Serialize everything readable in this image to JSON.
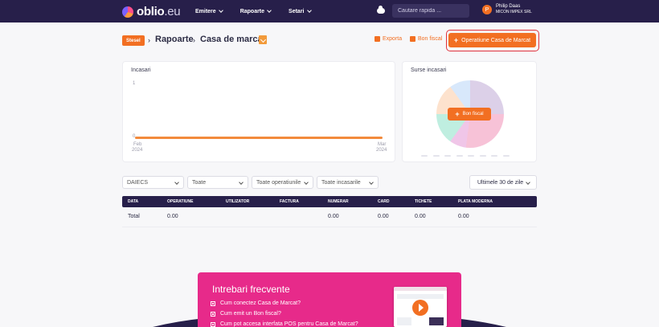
{
  "brand": {
    "logo_main": "oblio",
    "logo_suffix": ".eu"
  },
  "nav": {
    "items": [
      "Emitere",
      "Rapoarte",
      "Setari"
    ]
  },
  "search": {
    "placeholder": "Cautare rapida ..."
  },
  "user": {
    "initial": "P",
    "name": "Philip Daas",
    "company": "MICON IMPEX SRL"
  },
  "breadcrumb": {
    "badge": "Stesel",
    "section": "Rapoarte",
    "page": "Casa de marcat"
  },
  "actions": {
    "export": "Exporta",
    "receipt": "Bon fiscal",
    "primary": "Operatiune Casa de Marcat"
  },
  "income_chart": {
    "title": "Incasari",
    "y_top": "1",
    "y_zero": "0",
    "x_left": [
      "Feb",
      "2024"
    ],
    "x_right": [
      "Mar",
      "2024"
    ]
  },
  "chart_data": [
    {
      "type": "line",
      "title": "Incasari",
      "x": [
        "Feb 2024",
        "Mar 2024"
      ],
      "series": [
        {
          "values": [
            0,
            0
          ]
        }
      ],
      "ylim": [
        0,
        1
      ],
      "grid": false
    }
  ],
  "sources_chart": {
    "title": "Surse incasari",
    "button": "Bon fiscal"
  },
  "filters": {
    "f1": "DAIECS",
    "f2": "Toate",
    "f3": "Toate operatiunile",
    "f4": "Toate incasarile",
    "range": "Ultimele 30 de zile"
  },
  "table": {
    "headers": [
      "DATA",
      "OPERATIUNE",
      "UTILIZATOR",
      "FACTURA",
      "NUMERAR",
      "CARD",
      "TICHETE",
      "PLATA MODERNA"
    ],
    "total_row": {
      "label": "Total",
      "operatiune": "0.00",
      "numerar": "0.00",
      "card": "0.00",
      "tichete": "0.00",
      "plata_moderna": "0.00"
    }
  },
  "faq": {
    "title": "Intrebari frecvente",
    "items": [
      "Cum conectez Casa de Marcat?",
      "Cum emit un Bon fiscal?",
      "Cum pot accesa interfata POS pentru Casa de Marcat?"
    ]
  },
  "colors": {
    "nav_bg": "#271f4a",
    "accent": "#f26f22",
    "faq_bg": "#e72a8a",
    "highlight": "#e0323c"
  }
}
